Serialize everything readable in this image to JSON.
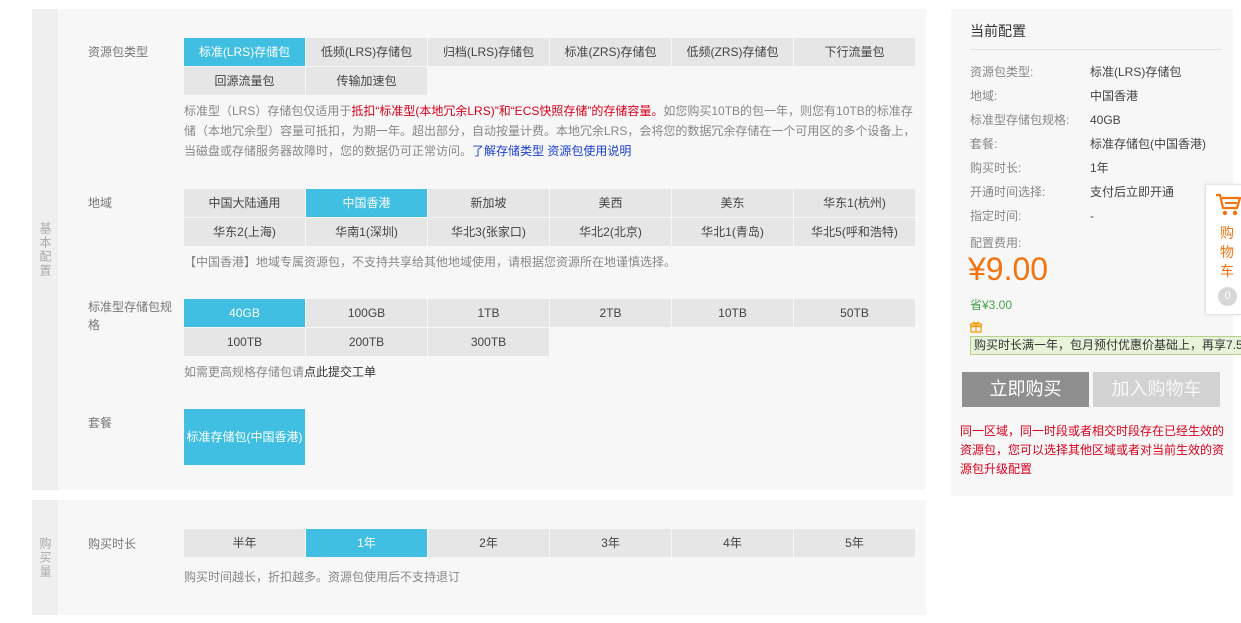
{
  "basic": {
    "side_label": "基本配置",
    "package_type": {
      "label": "资源包类型",
      "options": [
        "标准(LRS)存储包",
        "低频(LRS)存储包",
        "归档(LRS)存储包",
        "标准(ZRS)存储包",
        "低频(ZRS)存储包",
        "下行流量包",
        "回源流量包",
        "传输加速包"
      ],
      "selected": 0,
      "note_1": "标准型（LRS）存储包仅适用于",
      "note_red": "抵扣“标准型(本地冗余LRS)”和“ECS快照存储”的存储容量。",
      "note_2": "如您购买10TB的包一年，则您有10TB的标准存储（本地冗余型）容量可抵扣，为期一年。超出部分，自动按量计费。本地冗余LRS，会将您的数据冗余存储在一个可用区的多个设备上，当磁盘或存储服务器故障时，您的数据仍可正常访问。",
      "link_1": "了解存储类型",
      "link_2": "资源包使用说明"
    },
    "region": {
      "label": "地域",
      "options": [
        "中国大陆通用",
        "中国香港",
        "新加坡",
        "美西",
        "美东",
        "华东1(杭州)",
        "华东2(上海)",
        "华南1(深圳)",
        "华北3(张家口)",
        "华北2(北京)",
        "华北1(青岛)",
        "华北5(呼和浩特)"
      ],
      "selected": 1,
      "note": "【中国香港】地域专属资源包，不支持共享给其他地域使用，请根据您资源所在地谨慎选择。"
    },
    "spec": {
      "label": "标准型存储包规格",
      "options": [
        "40GB",
        "100GB",
        "1TB",
        "2TB",
        "10TB",
        "50TB",
        "100TB",
        "200TB",
        "300TB"
      ],
      "selected": 0,
      "note_prefix": "如需更高规格存储包请",
      "note_link": "点此提交工单"
    },
    "plan": {
      "label": "套餐",
      "option": "标准存储包(中国香港)"
    }
  },
  "buy": {
    "side_label": "购买量",
    "duration": {
      "label": "购买时长",
      "options": [
        "半年",
        "1年",
        "2年",
        "3年",
        "4年",
        "5年"
      ],
      "selected": 1,
      "note": "购买时间越长，折扣越多。资源包使用后不支持退订"
    }
  },
  "summary": {
    "title": "当前配置",
    "rows": [
      {
        "k": "资源包类型:",
        "v": "标准(LRS)存储包"
      },
      {
        "k": "地域:",
        "v": "中国香港"
      },
      {
        "k": "标准型存储包规格:",
        "v": "40GB"
      },
      {
        "k": "套餐:",
        "v": "标准存储包(中国香港)"
      },
      {
        "k": "购买时长:",
        "v": "1年"
      },
      {
        "k": "开通时间选择:",
        "v": "支付后立即开通"
      },
      {
        "k": "指定时间:",
        "v": "-"
      }
    ],
    "fee_label": "配置费用:",
    "price": "¥9.00",
    "saved": "省¥3.00",
    "promo": "购买时长满一年，包月预付优惠价基础上，再享7.5",
    "buy_button": "立即购买",
    "cart_button": "加入购物车",
    "warning": "同一区域，同一时段或者相交时段存在已经生效的资源包，您可以选择其他区域或者对当前生效的资源包升级配置"
  },
  "cart": {
    "label": "购物车",
    "count": "0"
  },
  "colors": {
    "selected": "#40bfe3",
    "price": "#f5730e",
    "warning": "#d9001b",
    "link": "#1a3fd0"
  }
}
